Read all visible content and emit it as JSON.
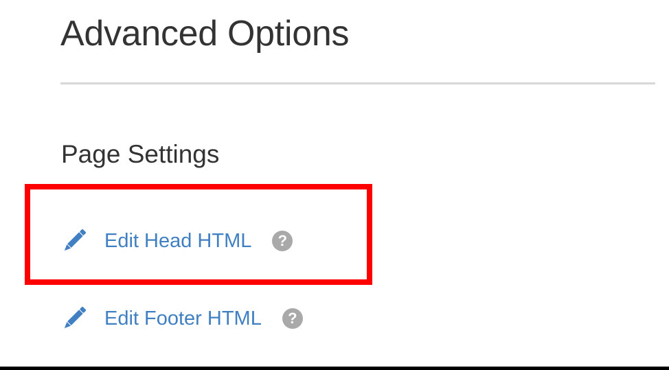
{
  "page": {
    "title": "Advanced Options"
  },
  "section": {
    "heading": "Page Settings"
  },
  "links": [
    {
      "label": "Edit Head HTML",
      "icon": "pencil-icon",
      "help_icon": "question-circle-icon",
      "help_glyph": "?"
    },
    {
      "label": "Edit Footer HTML",
      "icon": "pencil-icon",
      "help_icon": "question-circle-icon",
      "help_glyph": "?"
    }
  ],
  "colors": {
    "link": "#3f7fc2",
    "heading": "#333333",
    "help_icon": "#a9a9a9",
    "highlight": "#ff0000"
  }
}
